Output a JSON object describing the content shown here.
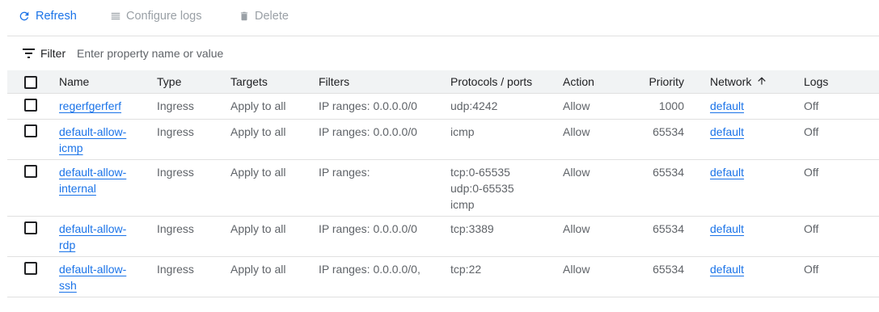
{
  "toolbar": {
    "refresh_label": "Refresh",
    "configure_logs_label": "Configure logs",
    "delete_label": "Delete"
  },
  "filter": {
    "label": "Filter",
    "placeholder": "Enter property name or value"
  },
  "table": {
    "headers": {
      "name": "Name",
      "type": "Type",
      "targets": "Targets",
      "filters": "Filters",
      "protocols_ports": "Protocols / ports",
      "action": "Action",
      "priority": "Priority",
      "network": "Network",
      "logs": "Logs"
    },
    "sort": {
      "column": "network",
      "direction": "ascending",
      "icon": "arrow-up-icon"
    },
    "rows": [
      {
        "name": "regerfgerferf",
        "type": "Ingress",
        "targets": "Apply to all",
        "filters": "IP ranges: 0.0.0.0/0",
        "protocols": [
          "udp:4242"
        ],
        "action": "Allow",
        "priority": "1000",
        "network": "default",
        "logs": "Off"
      },
      {
        "name": "default-allow-icmp",
        "type": "Ingress",
        "targets": "Apply to all",
        "filters": "IP ranges: 0.0.0.0/0",
        "protocols": [
          "icmp"
        ],
        "action": "Allow",
        "priority": "65534",
        "network": "default",
        "logs": "Off"
      },
      {
        "name": "default-allow-internal",
        "type": "Ingress",
        "targets": "Apply to all",
        "filters": "IP ranges:",
        "protocols": [
          "tcp:0-65535",
          "udp:0-65535",
          "icmp"
        ],
        "action": "Allow",
        "priority": "65534",
        "network": "default",
        "logs": "Off"
      },
      {
        "name": "default-allow-rdp",
        "type": "Ingress",
        "targets": "Apply to all",
        "filters": "IP ranges: 0.0.0.0/0",
        "protocols": [
          "tcp:3389"
        ],
        "action": "Allow",
        "priority": "65534",
        "network": "default",
        "logs": "Off"
      },
      {
        "name": "default-allow-ssh",
        "type": "Ingress",
        "targets": "Apply to all",
        "filters": "IP ranges: 0.0.0.0/0,",
        "protocols": [
          "tcp:22"
        ],
        "action": "Allow",
        "priority": "65534",
        "network": "default",
        "logs": "Off"
      }
    ]
  },
  "colors": {
    "accent": "#1a73e8",
    "disabled": "#9aa0a6",
    "header_bg": "#f1f3f4",
    "divider": "#e0e0e0"
  }
}
